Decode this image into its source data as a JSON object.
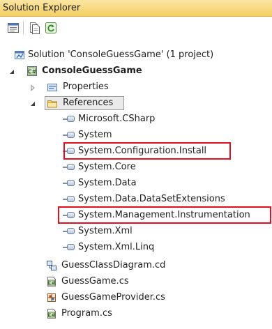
{
  "panel": {
    "title": "Solution Explorer"
  },
  "toolbar": {
    "buttons": [
      {
        "icon": "properties-icon"
      },
      {
        "icon": "show-all-files-icon"
      },
      {
        "icon": "refresh-icon"
      }
    ]
  },
  "tree": {
    "solution": "Solution 'ConsoleGuessGame' (1 project)",
    "project": "ConsoleGuessGame",
    "properties": "Properties",
    "references": "References",
    "reference_items": [
      "Microsoft.CSharp",
      "System",
      "System.Configuration.Install",
      "System.Core",
      "System.Data",
      "System.Data.DataSetExtensions",
      "System.Management.Instrumentation",
      "System.Xml",
      "System.Xml.Linq"
    ],
    "files": [
      "GuessClassDiagram.cd",
      "GuessGame.cs",
      "GuessGameProvider.cs",
      "Program.cs"
    ]
  },
  "colors": {
    "highlight": "#e0101e",
    "titlebar": "#f3cf63"
  }
}
